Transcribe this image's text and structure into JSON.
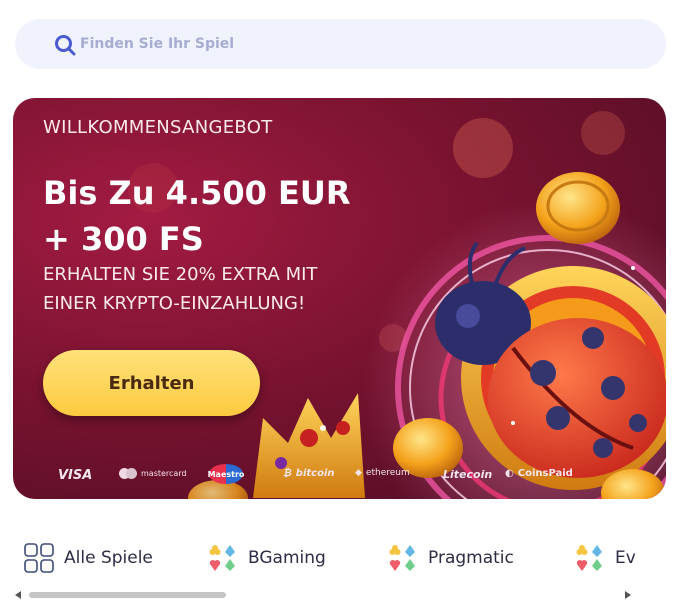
{
  "search": {
    "placeholder": "Finden Sie Ihr Spiel",
    "icon": "search-icon"
  },
  "banner": {
    "eyebrow": "WILLKOMMENSANGEBOT",
    "title_line1": "Bis Zu 4.500 EUR",
    "title_line2": "+ 300 FS",
    "subtitle_line1": "ERHALTEN SIE 20% EXTRA MIT",
    "subtitle_line2": "EINER KRYPTO-EINZAHLUNG!",
    "cta_label": "Erhalten",
    "payment_methods": [
      "VISA",
      "mastercard",
      "Maestro",
      "bitcoin",
      "ethereum",
      "Litecoin",
      "CoinsPaid"
    ],
    "colors": {
      "background": "#7a1330",
      "cta": "#fdca3f",
      "cta_text": "#4b2a12"
    }
  },
  "providers": [
    {
      "label": "Alle Spiele",
      "icon": "grid-icon"
    },
    {
      "label": "BGaming",
      "icon": "card-suits-icon"
    },
    {
      "label": "Pragmatic",
      "icon": "card-suits-icon"
    },
    {
      "label": "Ev",
      "icon": "card-suits-icon"
    }
  ]
}
